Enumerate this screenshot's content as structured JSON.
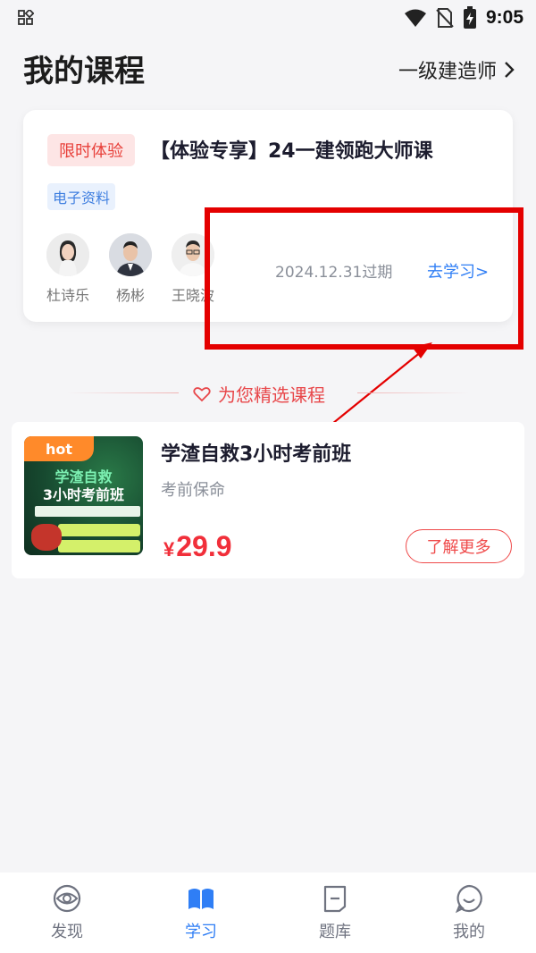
{
  "status_bar": {
    "time": "9:05"
  },
  "header": {
    "title": "我的课程",
    "category": "一级建造师"
  },
  "course_card": {
    "badge": "限时体验",
    "title": "【体验专享】24一建领跑大师课",
    "tag": "电子资料",
    "teachers": [
      {
        "name": "杜诗乐"
      },
      {
        "name": "杨彬"
      },
      {
        "name": "王晓波"
      }
    ],
    "expiry": "2024.12.31过期",
    "study_link": "去学习>"
  },
  "recommend_section": {
    "title": "为您精选课程"
  },
  "recommended_course": {
    "hot_label": "hot",
    "cover_title_line1": "学渣自救",
    "cover_title_line2": "3小时考前班",
    "title": "学渣自救3小时考前班",
    "subtitle": "考前保命",
    "price_symbol": "¥",
    "price": "29.9",
    "cta": "了解更多"
  },
  "bottom_nav": {
    "items": [
      {
        "label": "发现",
        "icon": "discover-eye-icon"
      },
      {
        "label": "学习",
        "icon": "book-icon"
      },
      {
        "label": "题库",
        "icon": "question-bank-icon"
      },
      {
        "label": "我的",
        "icon": "profile-smile-icon"
      }
    ],
    "active_index": 1
  },
  "colors": {
    "accent_blue": "#2f7ef5",
    "accent_red": "#f12f3a",
    "annotation_red": "#e40000"
  }
}
